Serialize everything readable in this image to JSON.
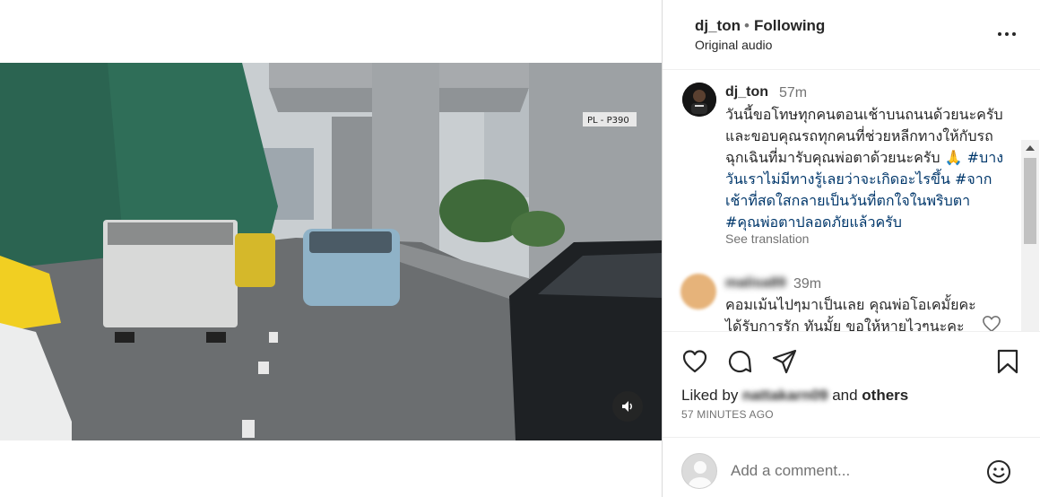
{
  "header": {
    "username": "dj_ton",
    "separator": "•",
    "follow_status": "Following",
    "audio": "Original audio",
    "more_icon": "more-horizontal-icon"
  },
  "video": {
    "description_signs": [
      "PL - P390"
    ],
    "mute_icon": "speaker-icon"
  },
  "caption": {
    "username": "dj_ton",
    "time": "57m",
    "text": "วันนี้ขอโทษทุกคนตอนเช้าบนถนนด้วยนะครับและขอบคุณรถทุกคนที่ช่วยหลีกทางให้กับรถฉุกเฉินที่มารับคุณพ่อตาด้วยนะครับ 🙏",
    "hashtags": [
      "#บางวันเราไม่มีทางรู้เลยว่าจะเกิดอะไรขึ้น",
      "#จากเช้าที่สดใสกลายเป็นวันที่ตกใจในพริบตา",
      "#คุณพ่อตาปลอดภัยแล้วครับ"
    ],
    "see_translation": "See translation"
  },
  "comment": {
    "username": "malisa89",
    "time": "39m",
    "text": "คอมเม้นไปๆมาเป็นเลย คุณพ่อโอเคมั้ยคะ ได้รับการรัก ทันมั้ย ขอให้หายไวๆนะคะ"
  },
  "actions": {
    "liked_by_prefix": "Liked by ",
    "liked_by_user": "nattakarn09",
    "liked_by_and": " and ",
    "liked_by_others": "others",
    "post_time": "57 MINUTES AGO"
  },
  "add_comment": {
    "placeholder": "Add a comment..."
  },
  "colors": {
    "text": "#262626",
    "secondary": "#737373",
    "hashtag": "#00376b",
    "border": "#dbdbdb"
  }
}
